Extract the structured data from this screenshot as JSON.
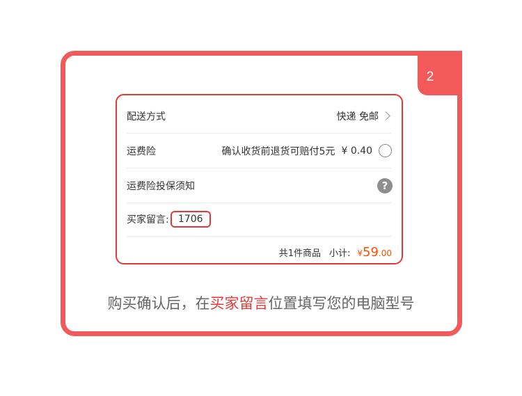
{
  "step_number": "2",
  "shipping": {
    "label": "配送方式",
    "value": "快递 免邮"
  },
  "insurance": {
    "label": "运费险",
    "description": "确认收货前退货可赔付5元",
    "price": "¥ 0.40"
  },
  "insurance_notice": {
    "label": "运费险投保须知"
  },
  "buyer_message": {
    "label": "买家留言:",
    "value": "1706"
  },
  "summary": {
    "count_text": "共1件商品",
    "subtotal_label": "小计:",
    "currency": "¥",
    "price_int": "59",
    "price_dec": ".00"
  },
  "caption": {
    "part1": "购买确认后，在",
    "highlight": "买家留言",
    "part2": "位置填写您的电脑型号"
  },
  "colors": {
    "accent": "#f25a5a",
    "price": "#ff5000"
  }
}
